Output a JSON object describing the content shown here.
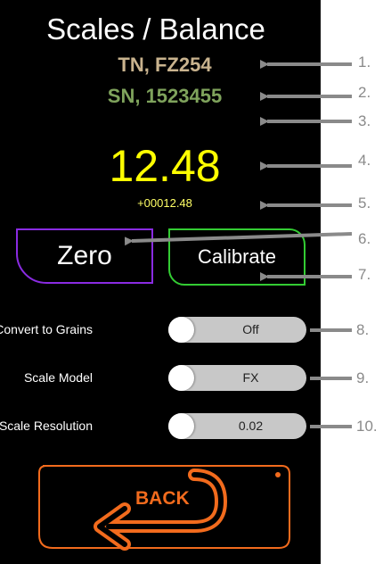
{
  "screen": {
    "title": "Scales / Balance",
    "tn_text": "TN, FZ254",
    "sn_text": "SN, 1523455",
    "weight": "12.48",
    "raw_reading": "+00012.48"
  },
  "buttons": {
    "zero_label": "Zero",
    "calibrate_label": "Calibrate",
    "back_label": "BACK"
  },
  "settings": [
    {
      "label": "Convert to Grains",
      "value": "Off"
    },
    {
      "label": "Scale Model",
      "value": "FX"
    },
    {
      "label": "Scale Resolution",
      "value": "0.02"
    }
  ],
  "annotations": [
    "1.",
    "2.",
    "3.",
    "4.",
    "5.",
    "6.",
    "7.",
    "8.",
    "9.",
    "10."
  ],
  "colors": {
    "screen_bg": "#000000",
    "tn": "#c9b38e",
    "sn": "#7fa35c",
    "weight": "#ffff00",
    "zero_border": "#8a2be2",
    "calibrate_border": "#33cc33",
    "back_accent": "#f26b1d",
    "annotation": "#8a8a8a"
  }
}
